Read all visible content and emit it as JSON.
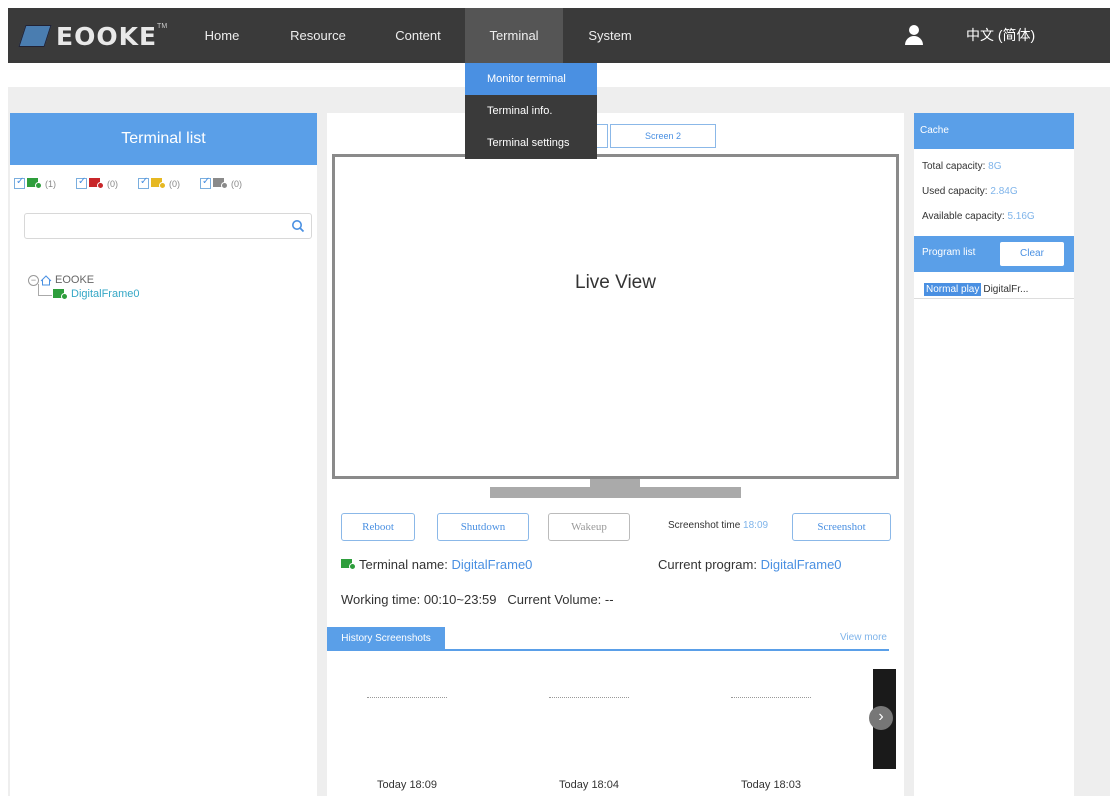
{
  "nav": {
    "logo": "EOOKE",
    "logo_tm": "TM",
    "items": [
      "Home",
      "Resource",
      "Content",
      "Terminal",
      "System"
    ],
    "active": "Terminal",
    "language": "中文 (简体)"
  },
  "dropdown": {
    "items": [
      "Monitor terminal",
      "Terminal info.",
      "Terminal settings"
    ],
    "hovered": "Monitor terminal"
  },
  "left": {
    "title": "Terminal list",
    "filters": [
      {
        "count": "(1)",
        "color": "#2e9e3c"
      },
      {
        "count": "(0)",
        "color": "#c8262a"
      },
      {
        "count": "(0)",
        "color": "#e6b822"
      },
      {
        "count": "(0)",
        "color": "#8a8a8a"
      }
    ],
    "search_placeholder": "",
    "tree": {
      "root": "EOOKE",
      "child": "DigitalFrame0"
    }
  },
  "center": {
    "tabs": [
      "",
      "Screen 2"
    ],
    "live_view": "Live View",
    "buttons": {
      "reboot": "Reboot",
      "shutdown": "Shutdown",
      "wakeup": "Wakeup",
      "screenshot": "Screenshot"
    },
    "screenshot_time_label": "Screenshot time",
    "screenshot_time_value": "18:09",
    "terminal_name_label": "Terminal name:",
    "terminal_name_value": "DigitalFrame0",
    "current_program_label": "Current program:",
    "current_program_value": "DigitalFrame0",
    "working_time_label": "Working time:",
    "working_time_value": "00:10~23:59",
    "volume_label": "Current Volume:",
    "volume_value": "--",
    "history_title": "History Screenshots",
    "view_more": "View more",
    "thumbs": [
      "Today 18:09",
      "Today 18:04",
      "Today 18:03"
    ]
  },
  "right": {
    "cache_title": "Cache",
    "total_label": "Total capacity:",
    "total_value": "8G",
    "used_label": "Used capacity:",
    "used_value": "2.84G",
    "avail_label": "Available capacity:",
    "avail_value": "5.16G",
    "program_list_title": "Program list",
    "clear_label": "Clear",
    "program_badge": "Normal play",
    "program_name": "DigitalFr..."
  },
  "colors": {
    "accent": "#5a9fe8",
    "navbar": "#3a3a3a",
    "link": "#4a90e2"
  }
}
